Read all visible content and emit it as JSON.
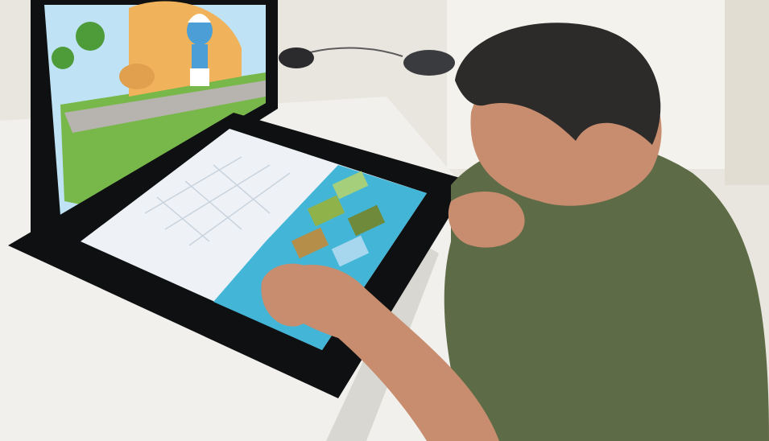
{
  "scene": {
    "alt": "",
    "colors": {
      "wall": "#e9e6df",
      "desk": "#f1f0ec",
      "bezel": "#0f1012",
      "sky": "#bfe3f5",
      "grass": "#78b74a",
      "cartoon_blue": "#4c9fd6",
      "touch_panel": "#43b6d8",
      "tablet_surface": "#eef2f7",
      "shirt": "#5e6b47",
      "hair": "#2d2b2a",
      "skin": "#c78d6e"
    },
    "icons": [
      "monitor-icon",
      "touch-table-icon",
      "person-icon",
      "mouse-icon"
    ]
  }
}
